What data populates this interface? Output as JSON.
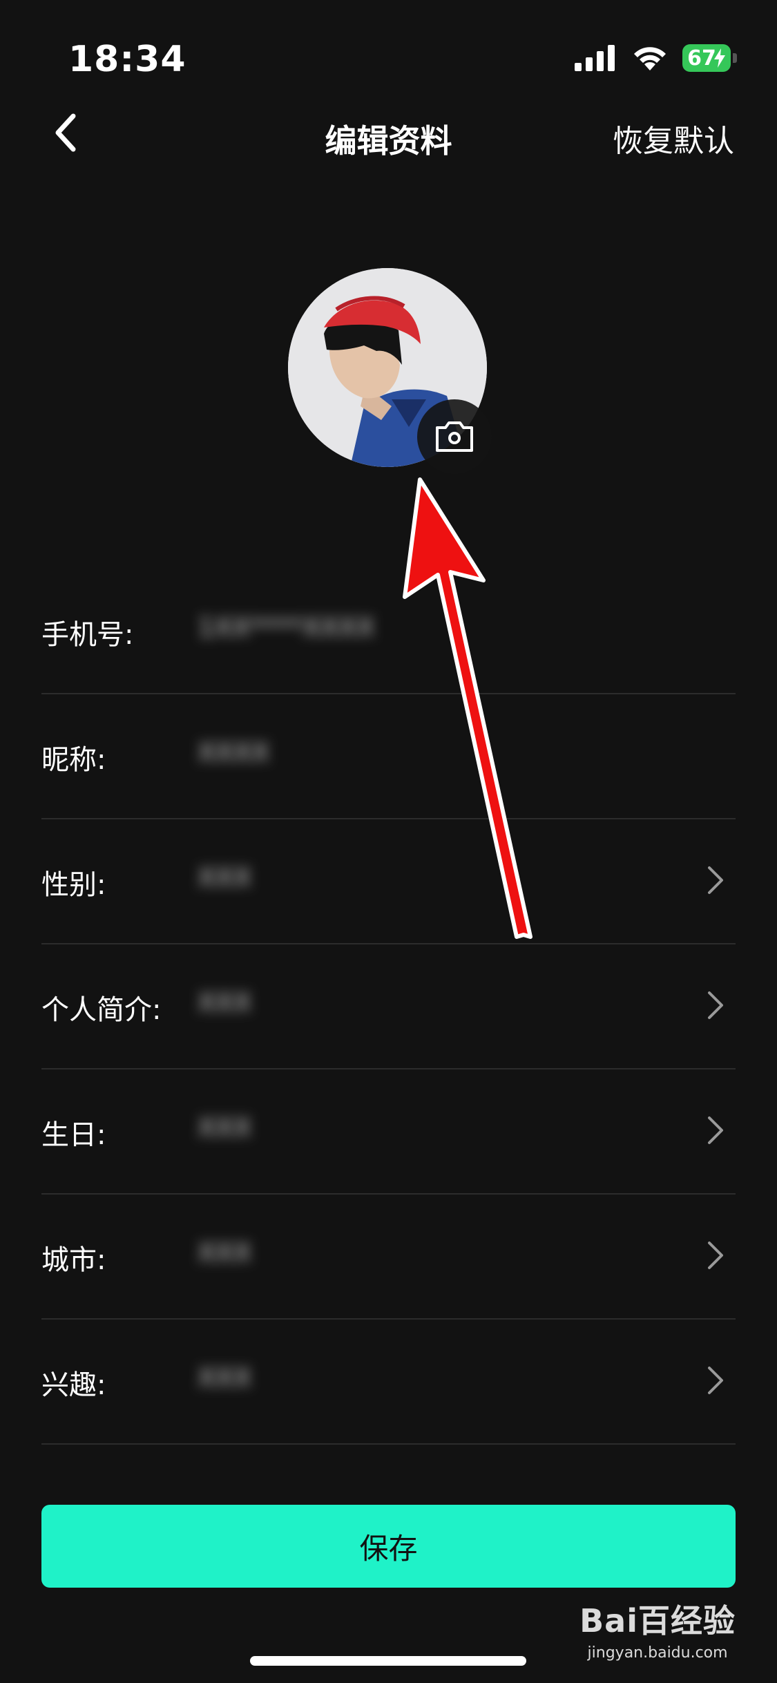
{
  "status_bar": {
    "time": "18:34",
    "battery": "67",
    "icons": [
      "signal-icon",
      "wifi-icon",
      "battery-icon"
    ]
  },
  "nav": {
    "back_icon": "chevron-left-icon",
    "title": "编辑资料",
    "action": "恢复默认"
  },
  "avatar": {
    "camera_icon": "camera-icon"
  },
  "form": {
    "rows": [
      {
        "label": "手机号:",
        "value": "1XX****XXXX",
        "has_chevron": false
      },
      {
        "label": "昵称:",
        "value": "XXXX",
        "has_chevron": false
      },
      {
        "label": "性别:",
        "value": "XXX",
        "has_chevron": true
      },
      {
        "label": "个人简介:",
        "value": "XXX",
        "has_chevron": true
      },
      {
        "label": "生日:",
        "value": "XXX",
        "has_chevron": true
      },
      {
        "label": "城市:",
        "value": "XXX",
        "has_chevron": true
      },
      {
        "label": "兴趣:",
        "value": "XXX",
        "has_chevron": true
      }
    ]
  },
  "save_button": {
    "label": "保存"
  },
  "watermark": {
    "logo": "Bai百经验",
    "url": "jingyan.baidu.com"
  },
  "colors": {
    "background": "#121212",
    "accent": "#1ff2c8",
    "battery": "#35c759",
    "annotation": "#ee1111"
  }
}
